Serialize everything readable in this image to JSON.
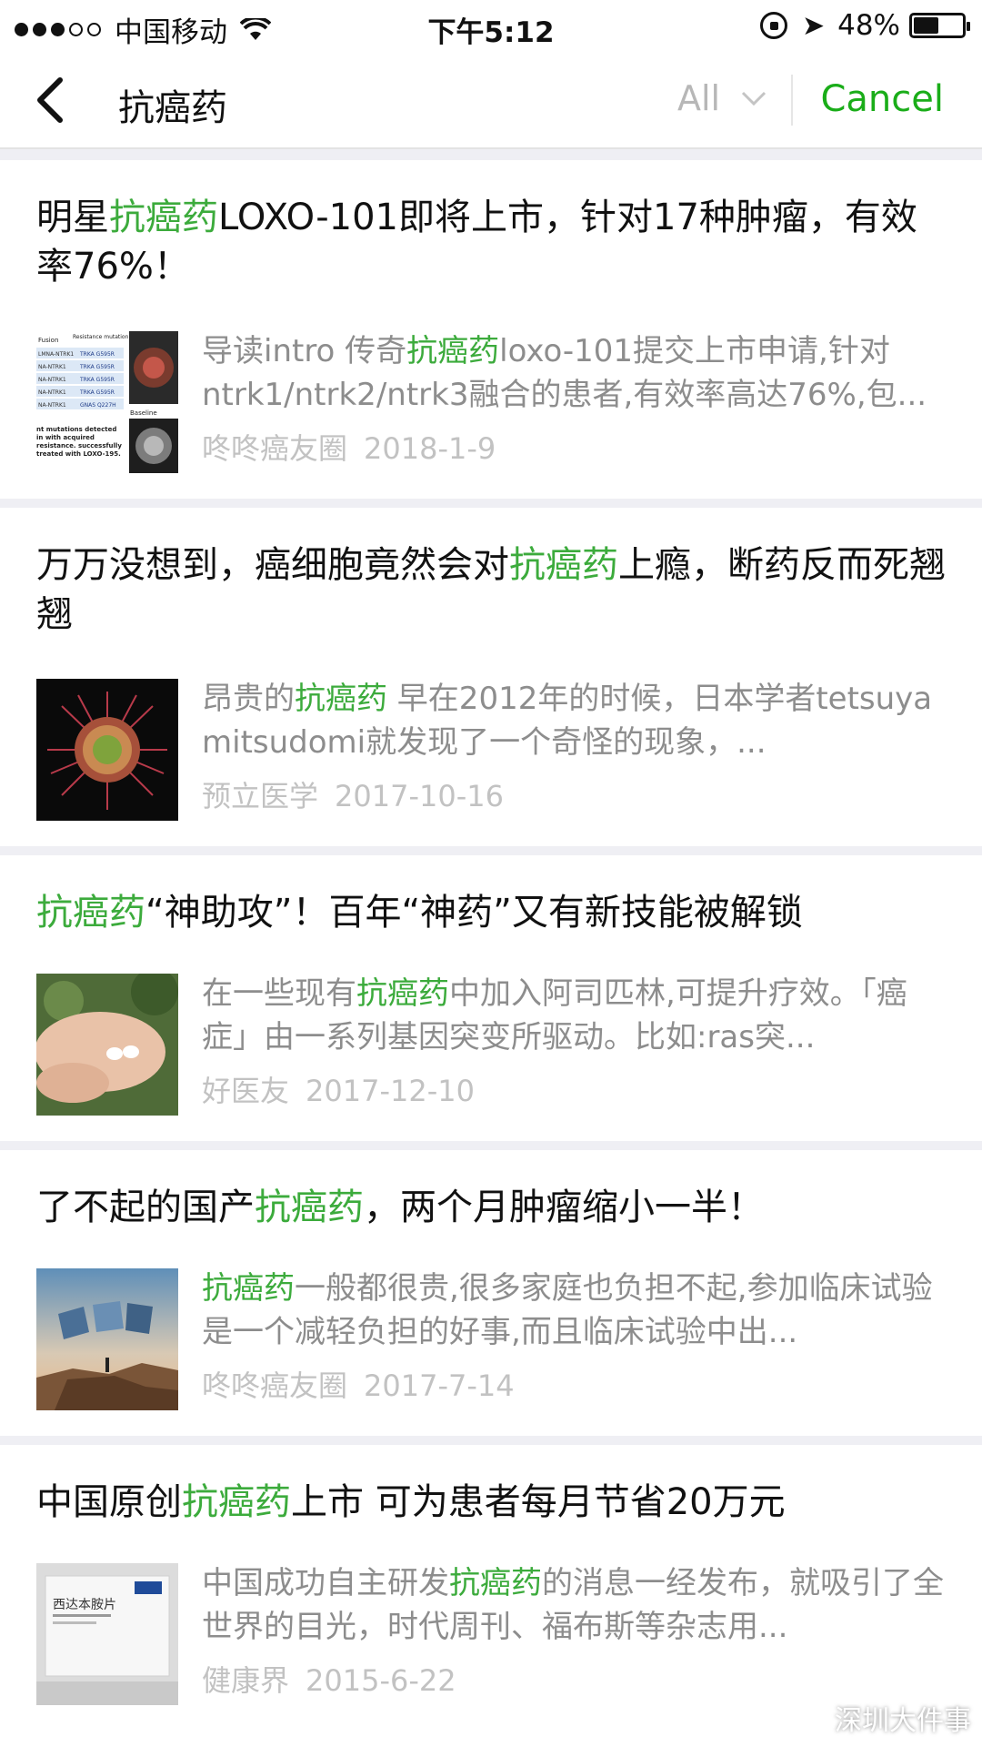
{
  "status_bar": {
    "carrier": "中国移动",
    "time": "下午5:12",
    "battery": "48%",
    "battery_level": 0.48
  },
  "nav": {
    "query": "抗癌药",
    "filter_label": "All",
    "cancel_label": "Cancel"
  },
  "results": [
    {
      "title_parts": [
        "明星",
        "抗癌药",
        "LOXO-101即将上市，针对17种肿瘤，有效率76%！"
      ],
      "snippet_parts": [
        "导读intro 传奇",
        "抗癌药",
        "loxo-101提交上市申请,针对ntrk1/ntrk2/ntrk3融合的患者,有效率高达76%,包..."
      ],
      "source": "咚咚癌友圈",
      "date": "2018-1-9",
      "thumb_text": {
        "col1": "Fusion",
        "col2": "Resistance mutation",
        "rows": [
          [
            "LMNA-NTRK1",
            "TRKA G595R"
          ],
          [
            "NA-NTRK1",
            "TRKA G595R"
          ],
          [
            "NA-NTRK1",
            "TRKA G595R"
          ],
          [
            "NA-NTRK1",
            "TRKA G595R"
          ],
          [
            "NA-NTRK1",
            "GNAS Q227H"
          ]
        ],
        "label": "Baseline",
        "note": "nt mutations detected in with acquired resistance. successfully treated with LOXO-195."
      }
    },
    {
      "title_parts": [
        "万万没想到，癌细胞竟然会对",
        "抗癌药",
        "上瘾，断药反而死翘翘"
      ],
      "snippet_parts": [
        "昂贵的",
        "抗癌药",
        " 早在2012年的时候，日本学者tetsuya mitsudomi就发现了一个奇怪的现象，..."
      ],
      "source": "预立医学",
      "date": "2017-10-16"
    },
    {
      "title_parts": [
        "",
        "抗癌药",
        "“神助攻”！百年“神药”又有新技能被解锁"
      ],
      "snippet_parts": [
        "在一些现有",
        "抗癌药",
        "中加入阿司匹林,可提升疗效。「癌症」由一系列基因突变所驱动。比如:ras突..."
      ],
      "source": "好医友",
      "date": "2017-12-10"
    },
    {
      "title_parts": [
        "了不起的国产",
        "抗癌药",
        "，两个月肿瘤缩小一半！"
      ],
      "snippet_parts": [
        "",
        "抗癌药",
        "一般都很贵,很多家庭也负担不起,参加临床试验是一个减轻负担的好事,而且临床试验中出..."
      ],
      "source": "咚咚癌友圈",
      "date": "2017-7-14"
    },
    {
      "title_parts": [
        "中国原创",
        "抗癌药",
        "上市 可为患者每月节省20万元"
      ],
      "snippet_parts": [
        "中国成功自主研发",
        "抗癌药",
        "的消息一经发布，就吸引了全世界的目光，时代周刊、福布斯等杂志用..."
      ],
      "source": "健康界",
      "date": "2015-6-22",
      "thumb_text": {
        "box_label": "西达本胺片"
      }
    }
  ],
  "watermark": {
    "text": "深圳大件事"
  },
  "colors": {
    "highlight": "#3cab3c",
    "cancel": "#1aad19"
  }
}
